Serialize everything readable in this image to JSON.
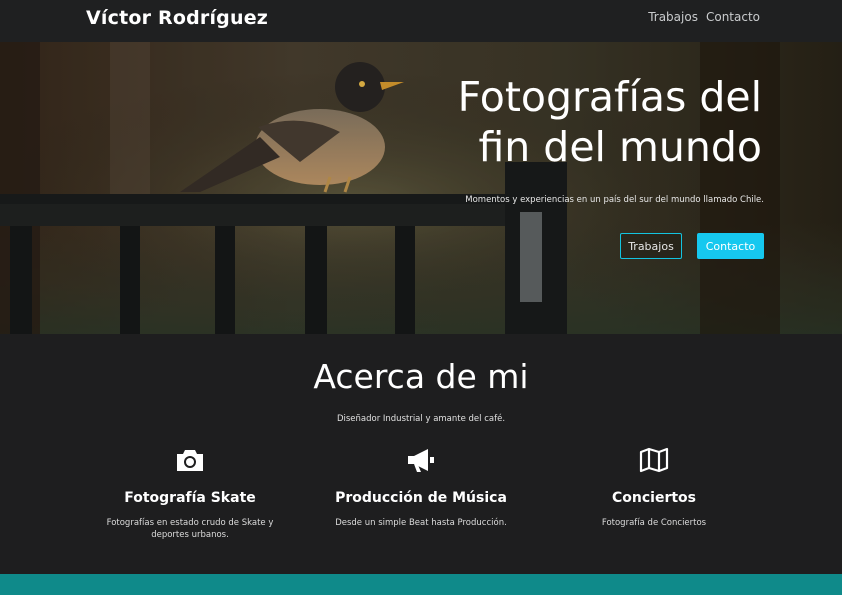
{
  "navbar": {
    "brand": "Víctor Rodríguez",
    "links": [
      "Trabajos",
      "Contacto"
    ]
  },
  "hero": {
    "title_line1": "Fotografías del",
    "title_line2": "fin del mundo",
    "subtitle": "Momentos y experiencias en un país del sur del mundo llamado Chile.",
    "btn_outline": "Trabajos",
    "btn_primary": "Contacto"
  },
  "about": {
    "title": "Acerca de mi",
    "subtitle": "Diseñador Industrial y amante del café.",
    "features": [
      {
        "icon": "camera-icon",
        "title": "Fotografía Skate",
        "desc": "Fotografías en estado crudo de Skate y deportes urbanos."
      },
      {
        "icon": "megaphone-icon",
        "title": "Producción de Música",
        "desc": "Desde un simple Beat hasta Producción."
      },
      {
        "icon": "map-icon",
        "title": "Conciertos",
        "desc": "Fotografía de Conciertos"
      }
    ]
  },
  "colors": {
    "accent": "#16c8ef",
    "teal_strip": "#0f8a8a",
    "background": "#1e1e1f"
  }
}
